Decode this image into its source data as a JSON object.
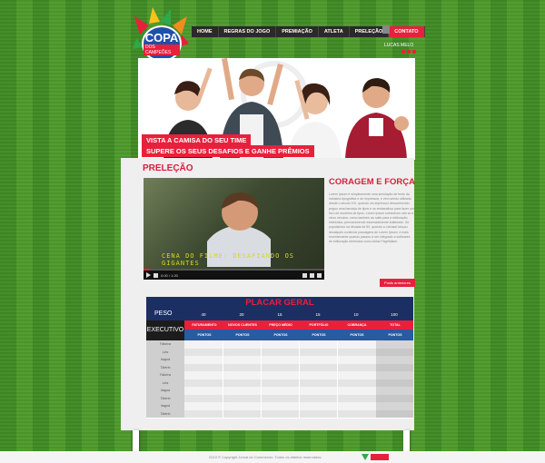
{
  "brand": {
    "logo_main": "COPA",
    "logo_sub": "DOS CAMPEÕES"
  },
  "nav": {
    "items": [
      {
        "label": "HOME",
        "active": false
      },
      {
        "label": "REGRAS DO JOGO",
        "active": false
      },
      {
        "label": "PREMIAÇÃO",
        "active": false
      },
      {
        "label": "ATLETA",
        "active": false
      },
      {
        "label": "PRELEÇÃO",
        "active": false
      },
      {
        "label": "CONTATO",
        "active": true
      }
    ]
  },
  "user": {
    "name": "LUCAS MELO",
    "logout_label": "sair"
  },
  "hero": {
    "caption_1": "VISTA A CAMISA DO SEU TIME",
    "caption_2": "SUPERE OS SEUS DESAFIOS E GANHE PRÊMIOS"
  },
  "section": {
    "title": "PRELEÇÃO"
  },
  "video": {
    "subtitle": "CENA DO FILME: DESAFIANDO OS GIGANTES",
    "time": "0:00 / 1:20",
    "progress": 0.03
  },
  "article": {
    "title": "CORAGEM E FORÇA",
    "body": "Lorem Ipsum é simplesmente uma simulação de texto da indústria tipográfica e de impressos, e vem sendo utilizado desde o século XVI, quando um impressor desconhecido pegou uma bandeja de tipos e os embaralhou para fazer um livro de modelos de tipos. Lorem Ipsum sobreviveu não só a cinco séculos, como também ao salto para a editoração eletrônica, permanecendo essencialmente inalterado. Se popularizou na década de 60, quando a Letraset lançou decalques contendo passagens de Lorem Ipsum, e mais recentemente quando passou a ser integrado a softwares de editoração eletrônica como Aldus PageMaker.",
    "prev_button": "Posts anteriores"
  },
  "placar": {
    "title": "PLACAR GERAL",
    "peso_label": "PESO",
    "executivo_label": "EXECUTIVO",
    "weights": [
      "40",
      "20",
      "15",
      "15",
      "10",
      "100"
    ],
    "columns": [
      "FATURAMENTO",
      "NOVOS CLIENTES",
      "PREÇO MÉDIO",
      "PORTFÓLIO",
      "COBRANÇA",
      "TOTAL"
    ],
    "pontos_label": "PONTOS",
    "rows": [
      "Fábrica",
      "Lins",
      "Itaguá",
      "Tiberto",
      "Fábrica",
      "Lins",
      "Itaguá",
      "Tiberto",
      "Itaguá",
      "Tiberto"
    ]
  },
  "footer": {
    "copyright": "2013 © Copyright Jornal do Commercio. Todos os direitos reservados."
  },
  "colors": {
    "accent": "#e8203c",
    "navy": "#1c2f63",
    "blue": "#2a5aa0",
    "grass": "#4e9a2c"
  }
}
